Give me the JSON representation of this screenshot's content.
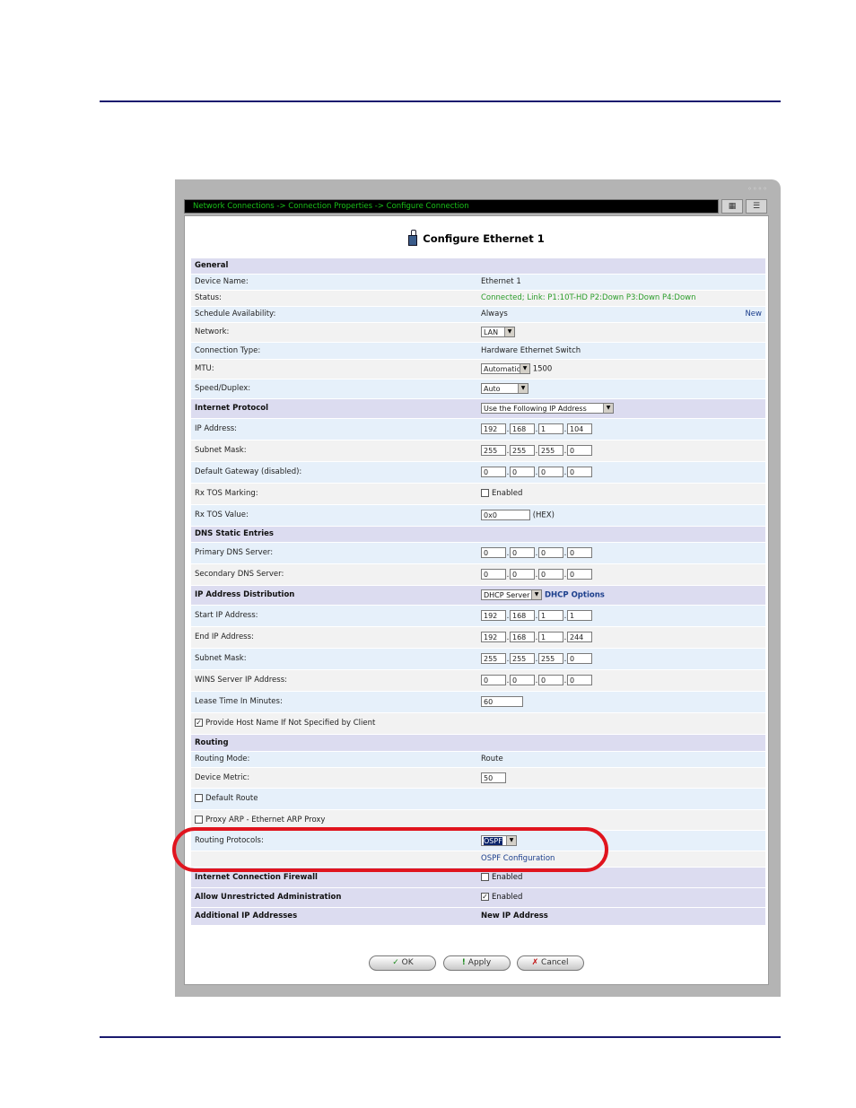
{
  "breadcrumb": "Network Connections -> Connection Properties -> Configure Connection",
  "page_title": "Configure Ethernet 1",
  "general": {
    "header": "General",
    "device_name_label": "Device Name:",
    "device_name_value": "Ethernet 1",
    "status_label": "Status:",
    "status_value": "Connected; Link: P1:10T-HD P2:Down P3:Down P4:Down",
    "schedule_label": "Schedule Availability:",
    "schedule_value": "Always",
    "schedule_new": "New",
    "network_label": "Network:",
    "network_value": "LAN",
    "conn_type_label": "Connection Type:",
    "conn_type_value": "Hardware Ethernet Switch",
    "mtu_label": "MTU:",
    "mtu_value": "Automatic",
    "mtu_number": "1500",
    "speed_label": "Speed/Duplex:",
    "speed_value": "Auto"
  },
  "internet_protocol": {
    "header": "Internet Protocol",
    "mode_value": "Use the Following IP Address",
    "ip_label": "IP Address:",
    "ip": [
      "192",
      "168",
      "1",
      "104"
    ],
    "mask_label": "Subnet Mask:",
    "mask": [
      "255",
      "255",
      "255",
      "0"
    ],
    "gw_label": "Default Gateway (disabled):",
    "gw": [
      "0",
      "0",
      "0",
      "0"
    ],
    "tos_mark_label": "Rx TOS Marking:",
    "tos_mark_value": "Enabled",
    "tos_value_label": "Rx TOS Value:",
    "tos_value": "0x0",
    "tos_unit": "(HEX)"
  },
  "dns": {
    "header": "DNS Static Entries",
    "primary_label": "Primary DNS Server:",
    "primary": [
      "0",
      "0",
      "0",
      "0"
    ],
    "secondary_label": "Secondary DNS Server:",
    "secondary": [
      "0",
      "0",
      "0",
      "0"
    ]
  },
  "dhcp": {
    "header": "IP Address Distribution",
    "mode_value": "DHCP Server",
    "options_link": "DHCP Options",
    "start_label": "Start IP Address:",
    "start": [
      "192",
      "168",
      "1",
      "1"
    ],
    "end_label": "End IP Address:",
    "end": [
      "192",
      "168",
      "1",
      "244"
    ],
    "mask_label": "Subnet Mask:",
    "mask": [
      "255",
      "255",
      "255",
      "0"
    ],
    "wins_label": "WINS Server IP Address:",
    "wins": [
      "0",
      "0",
      "0",
      "0"
    ],
    "lease_label": "Lease Time In Minutes:",
    "lease_value": "60",
    "hostname_label": "Provide Host Name If Not Specified by Client"
  },
  "routing": {
    "header": "Routing",
    "mode_label": "Routing Mode:",
    "mode_value": "Route",
    "metric_label": "Device Metric:",
    "metric_value": "50",
    "default_route_label": "Default Route",
    "proxy_arp_label": "Proxy ARP - Ethernet ARP Proxy",
    "protocols_label": "Routing Protocols:",
    "protocols_value": "OSPF",
    "ospf_link": "OSPF Configuration"
  },
  "firewall": {
    "header": "Internet Connection Firewall",
    "value": "Enabled"
  },
  "admin": {
    "header": "Allow Unrestricted Administration",
    "value": "Enabled"
  },
  "additional": {
    "header": "Additional IP Addresses",
    "link": "New IP Address"
  },
  "buttons": {
    "ok": "OK",
    "apply": "Apply",
    "cancel": "Cancel"
  },
  "icons": {
    "ok": "check-icon",
    "apply": "exclamation-icon",
    "cancel": "x-icon",
    "title": "ethernet-plug-icon"
  },
  "colors": {
    "highlight": "#e0141e",
    "section_bg": "#dcdcf0",
    "link": "#1b3e8c",
    "status": "#2a9c2a"
  }
}
